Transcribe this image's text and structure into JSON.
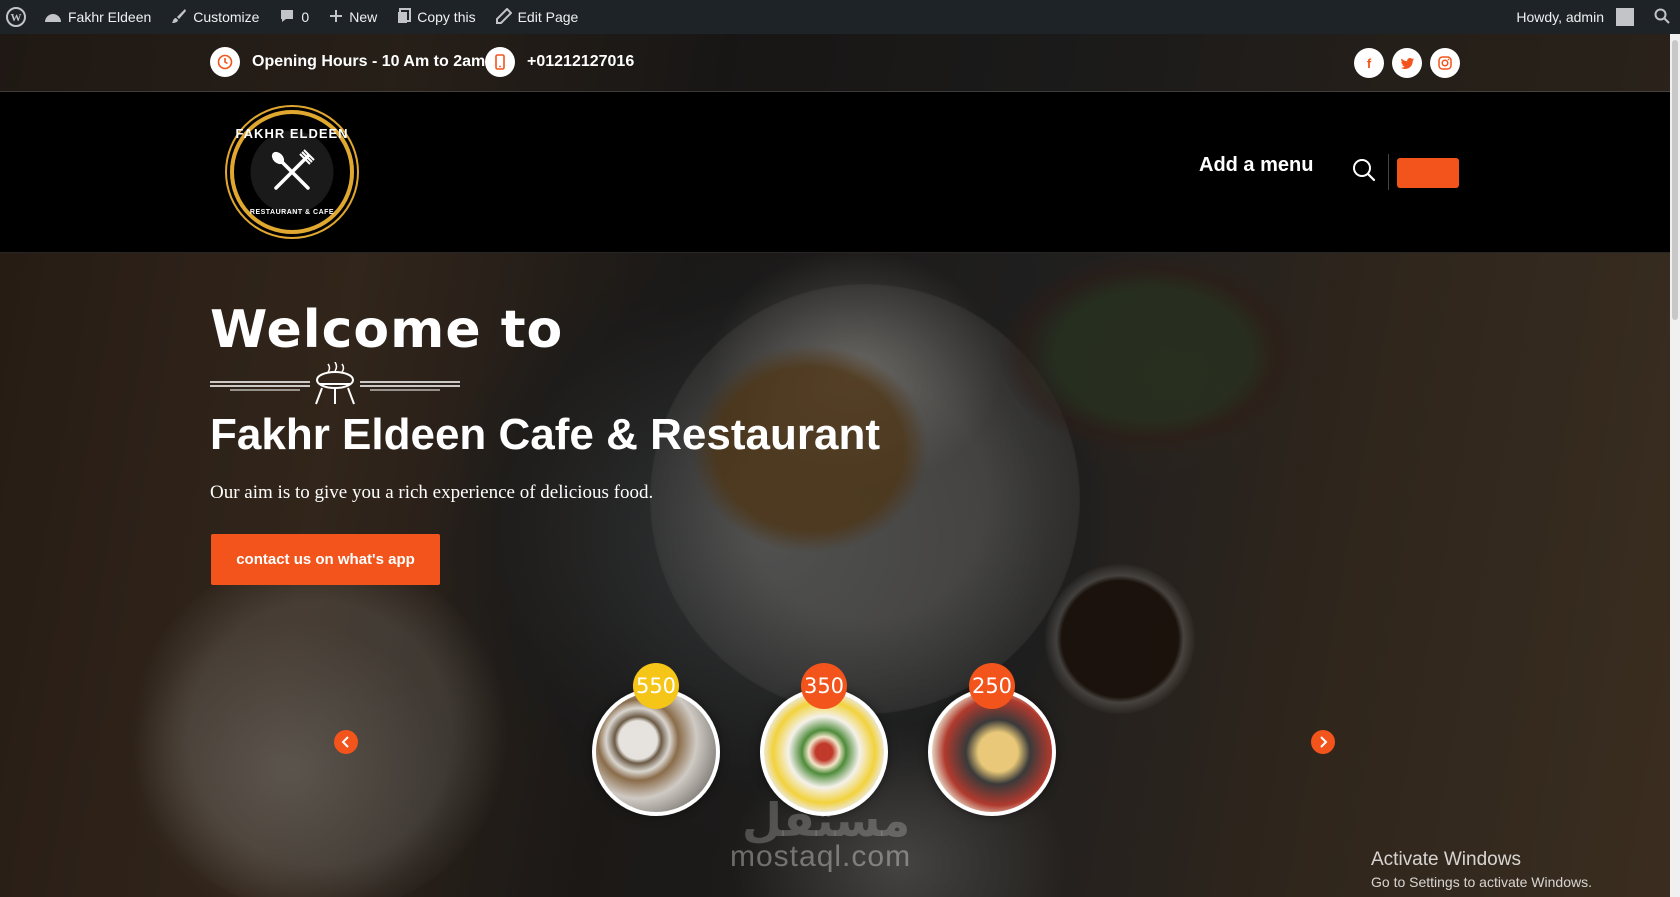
{
  "admin_bar": {
    "site_name": "Fakhr Eldeen",
    "customize": "Customize",
    "comments_count": "0",
    "new": "New",
    "copy": "Copy this",
    "edit_page": "Edit Page",
    "howdy": "Howdy, admin"
  },
  "topbar": {
    "hours": "Opening Hours - 10 Am to 2am",
    "phone": "+01212127016",
    "socials": [
      "facebook-icon",
      "twitter-icon",
      "instagram-icon"
    ]
  },
  "logo": {
    "top_text": "FAKHR ELDEEN",
    "bottom_text": "RESTAURANT & CAFE"
  },
  "nav": {
    "menu_label": "Add a menu"
  },
  "hero": {
    "welcome": "Welcome to",
    "title": "Fakhr Eldeen Cafe & Restaurant",
    "subtitle": "Our aim is to give you a rich experience of delicious food.",
    "cta": "contact us on what's app"
  },
  "slider": {
    "items": [
      {
        "price": "550",
        "badge_color": "#f5c518"
      },
      {
        "price": "350",
        "badge_color": "#f2541b"
      },
      {
        "price": "250",
        "badge_color": "#f2541b"
      }
    ]
  },
  "watermark": {
    "latin": "mostaql.com",
    "arabic": "مستقل"
  },
  "windows": {
    "title": "Activate Windows",
    "subtitle": "Go to Settings to activate Windows."
  },
  "colors": {
    "accent": "#f2541b",
    "admin_bar": "#1d2327",
    "header": "#000000"
  }
}
